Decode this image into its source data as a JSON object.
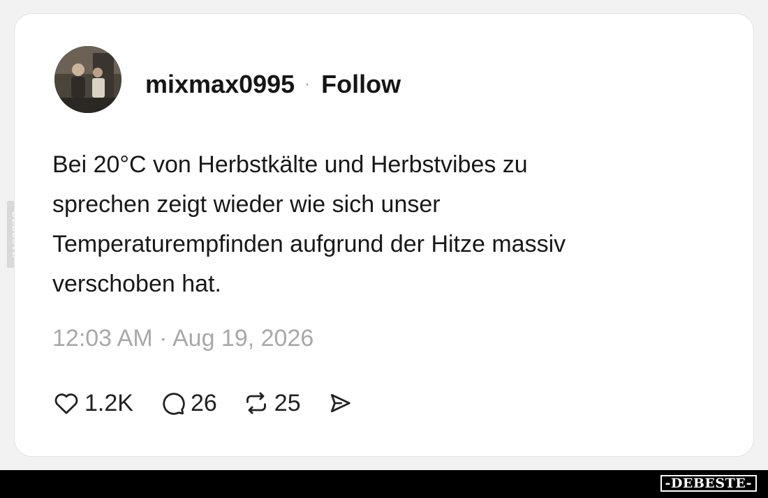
{
  "watermark": {
    "side_text": "DEBESTE",
    "brand_text": "-DEBESTE-"
  },
  "post": {
    "username": "mixmax0995",
    "separator": "·",
    "follow_label": "Follow",
    "text": "Bei 20°C von Herbstkälte und Herbstvibes zu\nsprechen zeigt wieder wie sich unser\nTemperaturempfinden aufgrund der Hitze massiv\nverschoben hat.",
    "timestamp": "12:03 AM · Aug 19, 2026",
    "actions": {
      "likes": "1.2K",
      "comments": "26",
      "reposts": "25"
    }
  },
  "icons": {
    "like": "heart-icon",
    "comment": "comment-bubble-icon",
    "repost": "repost-icon",
    "share": "send-icon"
  },
  "colors": {
    "card_bg": "#ffffff",
    "page_bg": "#f2f2f2",
    "text": "#181818",
    "muted": "#a8a8a8",
    "bar": "#000000"
  }
}
